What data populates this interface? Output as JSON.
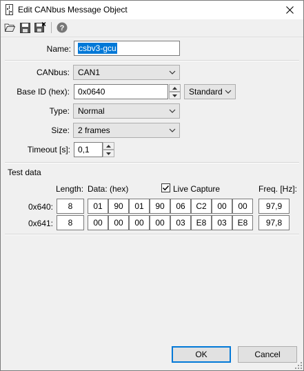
{
  "window": {
    "title": "Edit CANbus Message Object"
  },
  "toolbar": {
    "open_icon": "folder-open-icon",
    "save_icon": "save-icon",
    "save_as_icon": "save-as-icon",
    "help_icon": "help-icon",
    "help_glyph": "?"
  },
  "form": {
    "name_label": "Name:",
    "name_value": "csbv3-gcu",
    "canbus_label": "CANbus:",
    "canbus_value": "CAN1",
    "base_id_label": "Base ID (hex):",
    "base_id_value": "0x0640",
    "id_type_value": "Standard",
    "type_label": "Type:",
    "type_value": "Normal",
    "size_label": "Size:",
    "size_value": "2 frames",
    "timeout_label": "Timeout [s]:",
    "timeout_value": "0,1"
  },
  "test_data": {
    "section_title": "Test data",
    "length_header": "Length:",
    "data_header": "Data: (hex)",
    "live_capture_label": "Live Capture",
    "live_capture_checked": true,
    "freq_header": "Freq. [Hz]:",
    "rows": [
      {
        "id": "0x640:",
        "length": "8",
        "bytes": [
          "01",
          "90",
          "01",
          "90",
          "06",
          "C2",
          "00",
          "00"
        ],
        "freq": "97,9"
      },
      {
        "id": "0x641:",
        "length": "8",
        "bytes": [
          "00",
          "00",
          "00",
          "00",
          "03",
          "E8",
          "03",
          "E8"
        ],
        "freq": "97,8"
      }
    ]
  },
  "buttons": {
    "ok": "OK",
    "cancel": "Cancel"
  },
  "colors": {
    "selection": "#0078d7",
    "default_button_border": "#0078d7"
  }
}
